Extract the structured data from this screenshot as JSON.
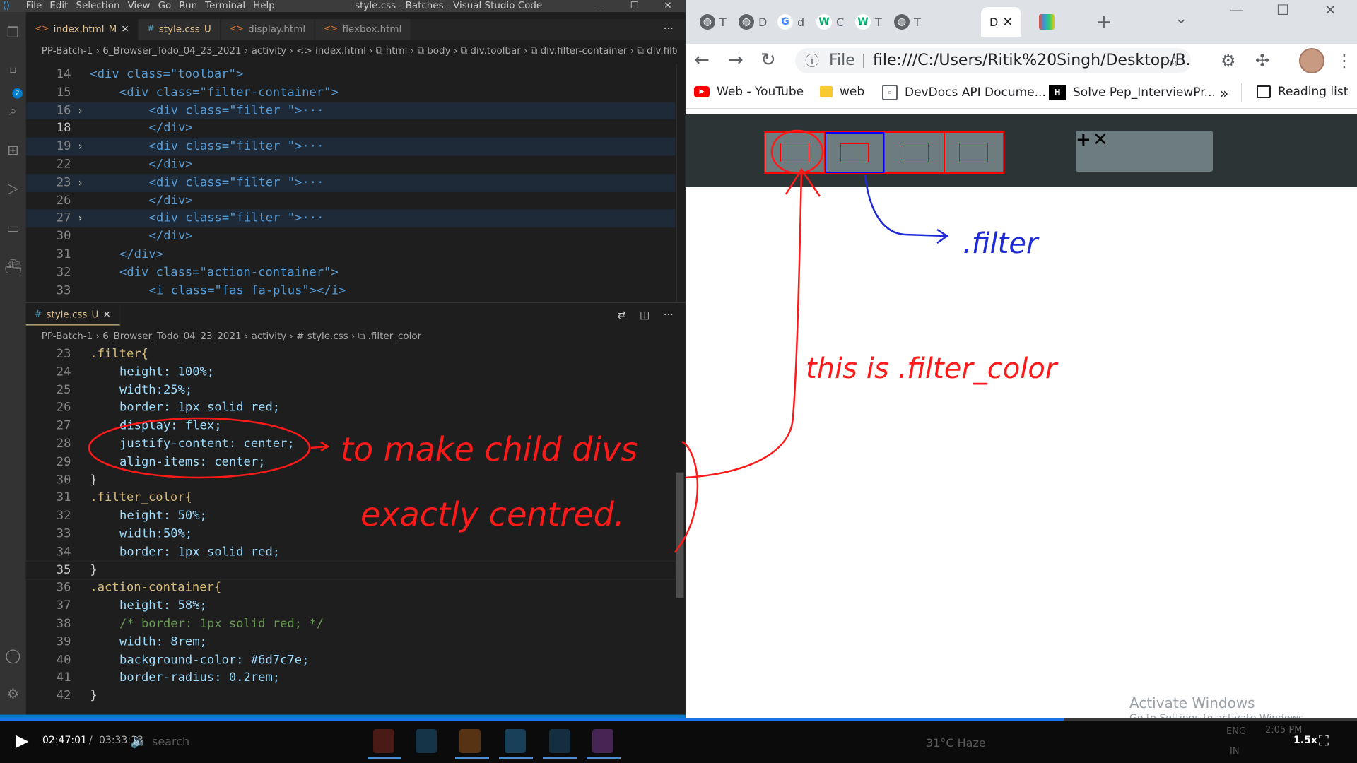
{
  "vscode": {
    "window_title": "style.css - Batches - Visual Studio Code",
    "menus": [
      "File",
      "Edit",
      "Selection",
      "View",
      "Go",
      "Run",
      "Terminal",
      "Help"
    ],
    "window_controls": {
      "minimize": "—",
      "maximize": "☐",
      "close": "✕"
    },
    "tabs": [
      {
        "name": "index.html",
        "status": "M",
        "icon": "html-file-icon"
      },
      {
        "name": "style.css",
        "status": "U",
        "icon": "css-file-icon"
      },
      {
        "name": "display.html",
        "status": "",
        "icon": "html-file-icon"
      },
      {
        "name": "flexbox.html",
        "status": "",
        "icon": "html-file-icon"
      }
    ],
    "breadcrumb_top": "PP-Batch-1 › 6_Browser_Todo_04_23_2021 › activity › <> index.html › ⧉ html › ⧉ body › ⧉ div.toolbar › ⧉ div.filter-container › ⧉ div.filter.",
    "html_lines": [
      {
        "n": "14",
        "code": "<div class=\"toolbar\">"
      },
      {
        "n": "15",
        "code": "<div class=\"filter-container\">"
      },
      {
        "n": "16",
        "code": "<div class=\"filter \">···"
      },
      {
        "n": "18",
        "code": "</div>"
      },
      {
        "n": "19",
        "code": "<div class=\"filter \">···"
      },
      {
        "n": "22",
        "code": "</div>"
      },
      {
        "n": "23",
        "code": "<div class=\"filter \">···"
      },
      {
        "n": "26",
        "code": "</div>"
      },
      {
        "n": "27",
        "code": "<div class=\"filter \">···"
      },
      {
        "n": "30",
        "code": "</div>"
      },
      {
        "n": "31",
        "code": "</div>"
      },
      {
        "n": "32",
        "code": "<div class=\"action-container\">"
      },
      {
        "n": "33",
        "code": "<i class=\"fas fa-plus\"></i>"
      }
    ],
    "css_tab": {
      "name": "style.css",
      "status": "U"
    },
    "breadcrumb_css": "PP-Batch-1 › 6_Browser_Todo_04_23_2021 › activity › # style.css › ⧉ .filter_color",
    "css_lines": [
      {
        "n": "23",
        "code": ".filter{"
      },
      {
        "n": "24",
        "code": "height: 100%;"
      },
      {
        "n": "25",
        "code": "width:25%;"
      },
      {
        "n": "26",
        "code": "border: 1px solid red;"
      },
      {
        "n": "27",
        "code": "display: flex;"
      },
      {
        "n": "28",
        "code": "justify-content: center;"
      },
      {
        "n": "29",
        "code": "align-items: center;"
      },
      {
        "n": "30",
        "code": "}"
      },
      {
        "n": "31",
        "code": ".filter_color{"
      },
      {
        "n": "32",
        "code": "height: 50%;"
      },
      {
        "n": "33",
        "code": "width:50%;"
      },
      {
        "n": "34",
        "code": "border: 1px solid red;"
      },
      {
        "n": "35",
        "code": "}"
      },
      {
        "n": "36",
        "code": ".action-container{"
      },
      {
        "n": "37",
        "code": "height: 58%;"
      },
      {
        "n": "38",
        "code": "/* border: 1px solid red; */"
      },
      {
        "n": "39",
        "code": "width: 8rem;"
      },
      {
        "n": "40",
        "code": "background-color: #6d7c7e;"
      },
      {
        "n": "41",
        "code": "border-radius: 0.2rem;"
      },
      {
        "n": "42",
        "code": "}"
      }
    ],
    "colors": {
      "red": "#ff0000",
      "gray": "#6d7c7e"
    }
  },
  "chrome": {
    "tabs": [
      "T",
      "D",
      "d",
      "C",
      "T",
      "T",
      "D"
    ],
    "active_tab": "D",
    "new_tab": "+",
    "url_label": "File",
    "url": "file:///C:/Users/Ritik%20Singh/Desktop/B...",
    "bookmarks": [
      "Web - YouTube",
      "web",
      "DevDocs API Docume...",
      "Solve Pep_InterviewPr..."
    ],
    "bookmarks_more": "»",
    "reading_list": "Reading list",
    "page": {
      "filter_count": 4,
      "action_icons": [
        "+",
        "✕"
      ],
      "colors": {
        "toolbar": "#2d3436",
        "filter_bg": "#6d7c7e",
        "action_bg": "#6d7c7e",
        "border": "#ff0000",
        "selected_border": "#0000ff"
      }
    },
    "watermark": {
      "title": "Activate Windows",
      "subtitle": "Go to Settings to activate Windows."
    }
  },
  "annotations": {
    "red_note": "to make child divs exactly centred.",
    "red_label": "this is .filter_color",
    "blue_label": ".filter"
  },
  "player": {
    "current_time": "02:47:01",
    "total_time": "03:33:13",
    "speed": "1.5x",
    "progress": 0.7838,
    "behind_weather": "31°C Haze",
    "behind_lang": [
      "ENG",
      "IN"
    ],
    "behind_time": "2:05 PM",
    "behind_search": "search"
  }
}
